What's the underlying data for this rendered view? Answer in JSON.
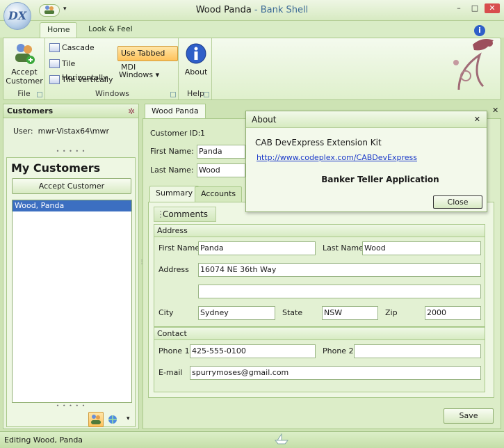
{
  "window": {
    "title_main": "Wood Panda",
    "title_sep": " - ",
    "title_app": "Bank Shell",
    "orb_label": "DX",
    "controls": {
      "minimize": "–",
      "maximize": "□",
      "close": "✕"
    }
  },
  "ribbon": {
    "tabs": [
      {
        "label": "Home",
        "active": true
      },
      {
        "label": "Look & Feel",
        "active": false
      }
    ],
    "groups": {
      "file": {
        "label": "File",
        "accept_customer": "Accept Customer"
      },
      "windows": {
        "label": "Windows",
        "cascade": "Cascade",
        "tile_horizontally": "Tile Horizontally",
        "tile_vertically": "Tile Vertically",
        "use_tabbed_mdi": "Use Tabbed MDI",
        "windows_menu": "Windows"
      },
      "help": {
        "label": "Help",
        "about": "About"
      }
    }
  },
  "left_pane": {
    "header": "Customers",
    "user_label": "User:",
    "user_value": "mwr-Vistax64\\mwr",
    "my_customers_title": "My Customers",
    "accept_button": "Accept Customer",
    "customers": [
      {
        "name": "Wood, Panda",
        "selected": true
      }
    ]
  },
  "document": {
    "tab_label": "Wood Panda",
    "customer_id_label": "Customer ID:",
    "customer_id": "1",
    "first_name_label": "First Name:",
    "first_name": "Panda",
    "last_name_label": "Last Name:",
    "last_name": "Wood",
    "sub_tabs": [
      {
        "label": "Summary",
        "active": true
      },
      {
        "label": "Accounts",
        "active": false
      }
    ],
    "comments_label": "Comments",
    "address_group": {
      "title": "Address",
      "first_name_label": "First Name",
      "first_name": "Panda",
      "last_name_label": "Last Name",
      "last_name": "Wood",
      "address_label": "Address",
      "address_line1": "16074 NE 36th Way",
      "address_line2": "",
      "city_label": "City",
      "city": "Sydney",
      "state_label": "State",
      "state": "NSW",
      "zip_label": "Zip",
      "zip": "2000"
    },
    "contact_group": {
      "title": "Contact",
      "phone1_label": "Phone 1",
      "phone1": "425-555-0100",
      "phone2_label": "Phone 2",
      "phone2": "",
      "email_label": "E-mail",
      "email": "spurrymoses@gmail.com"
    },
    "save_button": "Save"
  },
  "about_dialog": {
    "title": "About",
    "product": "CAB DevExpress Extension Kit",
    "url": "http://www.codeplex.com/CABDevExpress",
    "app_name": "Banker Teller Application",
    "close_button": "Close"
  },
  "status_bar": {
    "text": "Editing Wood, Panda"
  },
  "colors": {
    "accent": "#3c6fc1",
    "theme_green": "#cde3b4",
    "title_app": "#3c6a96"
  }
}
